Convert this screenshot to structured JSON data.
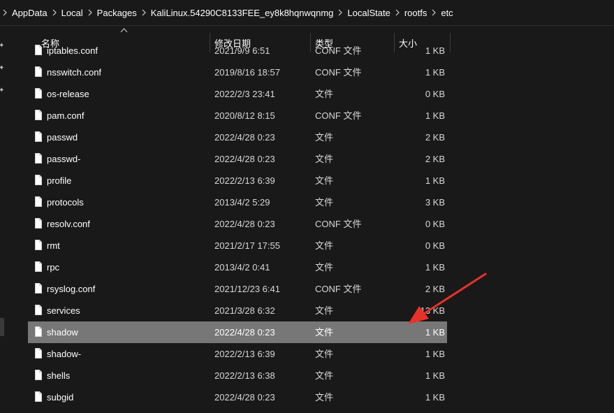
{
  "breadcrumb": {
    "items": [
      "AppData",
      "Local",
      "Packages",
      "KaliLinux.54290C8133FEE_ey8k8hqnwqnmg",
      "LocalState",
      "rootfs",
      "etc"
    ]
  },
  "columns": {
    "name": "名称",
    "modified": "修改日期",
    "type": "类型",
    "size": "大小"
  },
  "files": [
    {
      "name": "iptables.conf",
      "modified": "2021/9/9 6:51",
      "type": "CONF 文件",
      "size": "1 KB",
      "partial": true
    },
    {
      "name": "nsswitch.conf",
      "modified": "2019/8/16 18:57",
      "type": "CONF 文件",
      "size": "1 KB"
    },
    {
      "name": "os-release",
      "modified": "2022/2/3 23:41",
      "type": "文件",
      "size": "0 KB"
    },
    {
      "name": "pam.conf",
      "modified": "2020/8/12 8:15",
      "type": "CONF 文件",
      "size": "1 KB"
    },
    {
      "name": "passwd",
      "modified": "2022/4/28 0:23",
      "type": "文件",
      "size": "2 KB"
    },
    {
      "name": "passwd-",
      "modified": "2022/4/28 0:23",
      "type": "文件",
      "size": "2 KB"
    },
    {
      "name": "profile",
      "modified": "2022/2/13 6:39",
      "type": "文件",
      "size": "1 KB"
    },
    {
      "name": "protocols",
      "modified": "2013/4/2 5:29",
      "type": "文件",
      "size": "3 KB"
    },
    {
      "name": "resolv.conf",
      "modified": "2022/4/28 0:23",
      "type": "CONF 文件",
      "size": "0 KB"
    },
    {
      "name": "rmt",
      "modified": "2021/2/17 17:55",
      "type": "文件",
      "size": "0 KB"
    },
    {
      "name": "rpc",
      "modified": "2013/4/2 0:41",
      "type": "文件",
      "size": "1 KB"
    },
    {
      "name": "rsyslog.conf",
      "modified": "2021/12/23 6:41",
      "type": "CONF 文件",
      "size": "2 KB"
    },
    {
      "name": "services",
      "modified": "2021/3/28 6:32",
      "type": "文件",
      "size": "13 KB"
    },
    {
      "name": "shadow",
      "modified": "2022/4/28 0:23",
      "type": "文件",
      "size": "1 KB",
      "selected": true
    },
    {
      "name": "shadow-",
      "modified": "2022/2/13 6:39",
      "type": "文件",
      "size": "1 KB"
    },
    {
      "name": "shells",
      "modified": "2022/2/13 6:38",
      "type": "文件",
      "size": "1 KB"
    },
    {
      "name": "subgid",
      "modified": "2022/4/28 0:23",
      "type": "文件",
      "size": "1 KB"
    }
  ],
  "colors": {
    "background": "#191919",
    "selected_row": "#777777",
    "annotation_arrow": "#e8312a"
  },
  "icons": {
    "file": "file-icon",
    "breadcrumb_separator": "chevron-right-icon",
    "sort": "sort-up-icon",
    "quick_access_pin": "pin-icon"
  }
}
